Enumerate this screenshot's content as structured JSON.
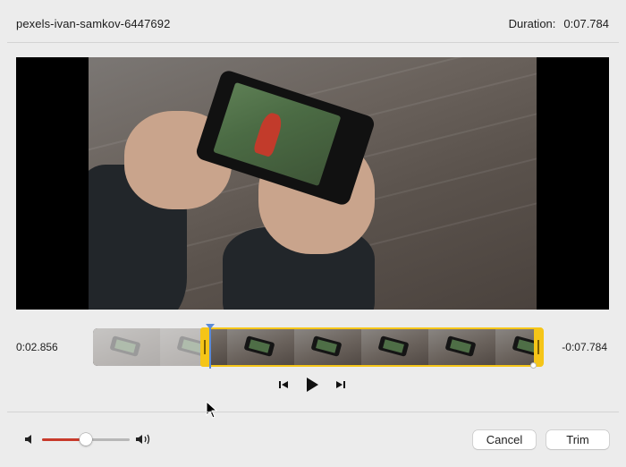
{
  "header": {
    "file_name": "pexels-ivan-samkov-6447692",
    "duration_label": "Duration:",
    "duration_value": "0:07.784"
  },
  "timeline": {
    "start_time": "0:02.856",
    "remaining_time": "-0:07.784",
    "trim_start_fraction": 0.24,
    "trim_end_fraction": 1.0
  },
  "playback": {
    "step_back_icon": "step-backward-icon",
    "play_icon": "play-icon",
    "step_forward_icon": "step-forward-icon"
  },
  "volume": {
    "level": 0.5,
    "low_icon": "speaker-low-icon",
    "high_icon": "speaker-high-icon",
    "fill_color": "#c83a2b"
  },
  "buttons": {
    "cancel": "Cancel",
    "trim": "Trim"
  },
  "colors": {
    "trim_accent": "#f5c518",
    "playhead": "#5b8ad6"
  }
}
